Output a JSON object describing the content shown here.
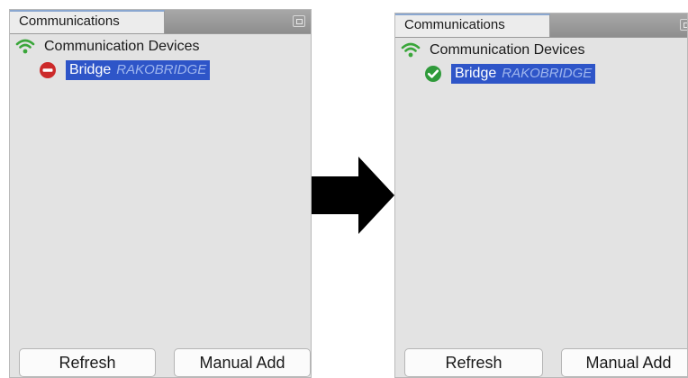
{
  "before": {
    "tab_label": "Communications",
    "tree_root_label": "Communication Devices",
    "device_name": "Bridge",
    "device_id": "RAKOBRIDGE",
    "status_icon": "no-entry-icon",
    "refresh_label": "Refresh",
    "manual_add_label": "Manual Add"
  },
  "after": {
    "tab_label": "Communications",
    "tree_root_label": "Communication Devices",
    "device_name": "Bridge",
    "device_id": "RAKOBRIDGE",
    "status_icon": "check-circle-icon",
    "refresh_label": "Refresh",
    "manual_add_label": "Manual Add"
  },
  "colors": {
    "selection": "#2e55c8",
    "wifi": "#3aa63a",
    "error": "#cc2a2a",
    "ok": "#2f9a3a",
    "arrow": "#000000"
  }
}
